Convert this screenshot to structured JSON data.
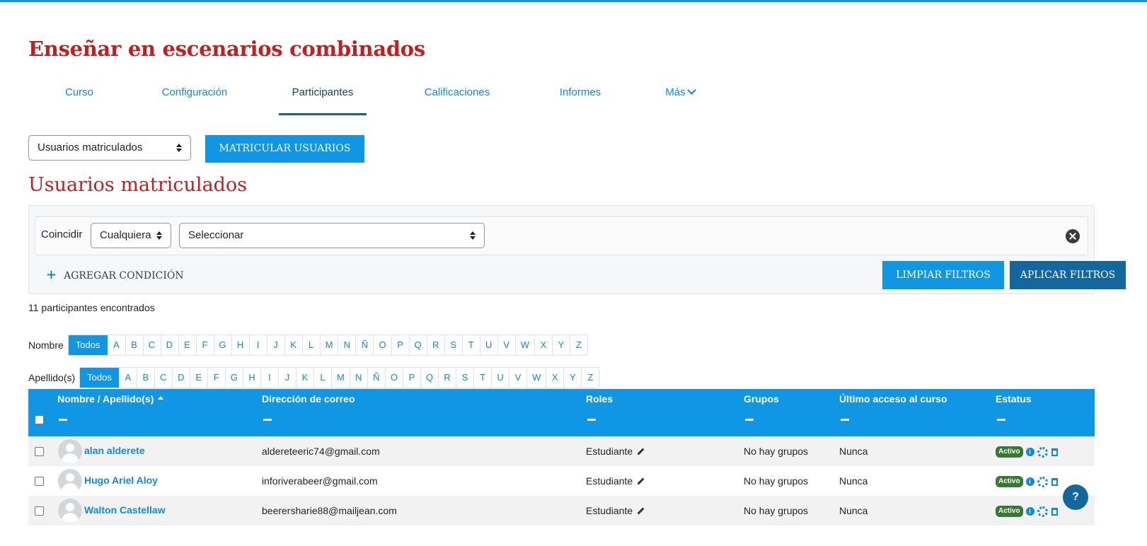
{
  "course_title": "Enseñar en escenarios combinados",
  "nav": {
    "tabs": [
      "Curso",
      "Configuración",
      "Participantes",
      "Calificaciones",
      "Informes",
      "Más"
    ],
    "active": "Participantes"
  },
  "toolbar": {
    "view_select": "Usuarios matriculados",
    "enrol_button": "MATRICULAR USUARIOS"
  },
  "section_title": "Usuarios matriculados",
  "filter": {
    "match_label": "Coincidir",
    "match_value": "Cualquiera",
    "type_value": "Seleccionar",
    "add_condition": "AGREGAR CONDICIÓN",
    "clear_button": "LIMPIAR FILTROS",
    "apply_button": "APLICAR FILTROS"
  },
  "count_text": "11 participantes encontrados",
  "initials": {
    "first_label": "Nombre",
    "last_label": "Apellido(s)",
    "all_label": "Todos",
    "letters": [
      "A",
      "B",
      "C",
      "D",
      "E",
      "F",
      "G",
      "H",
      "I",
      "J",
      "K",
      "L",
      "M",
      "N",
      "Ñ",
      "O",
      "P",
      "Q",
      "R",
      "S",
      "T",
      "U",
      "V",
      "W",
      "X",
      "Y",
      "Z"
    ]
  },
  "table": {
    "headers": {
      "name": "Nombre / Apellido(s)",
      "email": "Dirección de correo",
      "roles": "Roles",
      "groups": "Grupos",
      "last_access": "Último acceso al curso",
      "status": "Estatus"
    },
    "rows": [
      {
        "name": "alan alderete",
        "email": "aldereteeric74@gmail.com",
        "role": "Estudiante",
        "groups": "No hay grupos",
        "last_access": "Nunca",
        "status": "Activo"
      },
      {
        "name": "Hugo Ariel Aloy",
        "email": "inforiverabeer@gmail.com",
        "role": "Estudiante",
        "groups": "No hay grupos",
        "last_access": "Nunca",
        "status": "Activo"
      },
      {
        "name": "Walton Castellaw",
        "email": "beerersharie88@mailjean.com",
        "role": "Estudiante",
        "groups": "No hay grupos",
        "last_access": "Nunca",
        "status": "Activo"
      }
    ]
  },
  "colors": {
    "brand_red": "#c0201e",
    "primary_blue": "#0f97e6",
    "dark_blue": "#11679e",
    "active_green": "#357a32"
  },
  "help_button": "?"
}
